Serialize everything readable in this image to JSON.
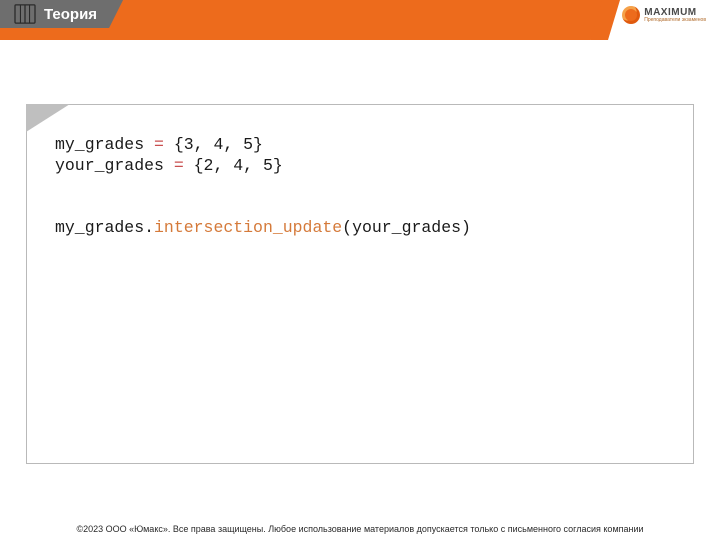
{
  "header": {
    "tab_label": "Теория",
    "logo_name": "MAXIMUM",
    "logo_sub": "Преподаватели экзаменов"
  },
  "code": {
    "line1_a": "my_grades ",
    "line1_op": "=",
    "line1_b": " {3, 4, 5}",
    "line2_a": "your_grades ",
    "line2_op": "=",
    "line2_b": " {2, 4, 5}",
    "line3_a": "my_grades.",
    "line3_fn": "intersection_update",
    "line3_b": "(your_grades)"
  },
  "footer": {
    "copyright": "©2023 ООО «Юмакс». Все права защищены. Любое использование материалов допускается только с письменного согласия компании"
  }
}
